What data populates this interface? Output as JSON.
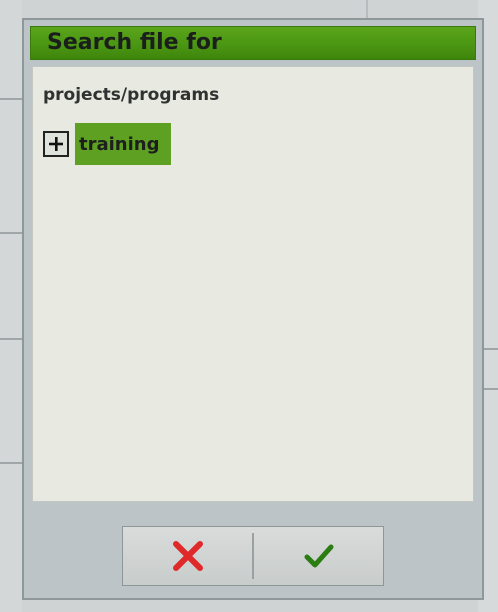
{
  "dialog": {
    "title": "Search file for",
    "path": "projects/programs",
    "tree": [
      {
        "label": "training",
        "expand_icon": "plus-icon",
        "selected": true
      }
    ],
    "buttons": {
      "cancel": {
        "icon": "close-icon",
        "color": "#e02a2a"
      },
      "confirm": {
        "icon": "checkmark-icon",
        "color": "#2b7d12"
      }
    }
  },
  "colors": {
    "title_bar": "#4b9613",
    "selection": "#5ea022",
    "panel": "#e8e9e1"
  }
}
